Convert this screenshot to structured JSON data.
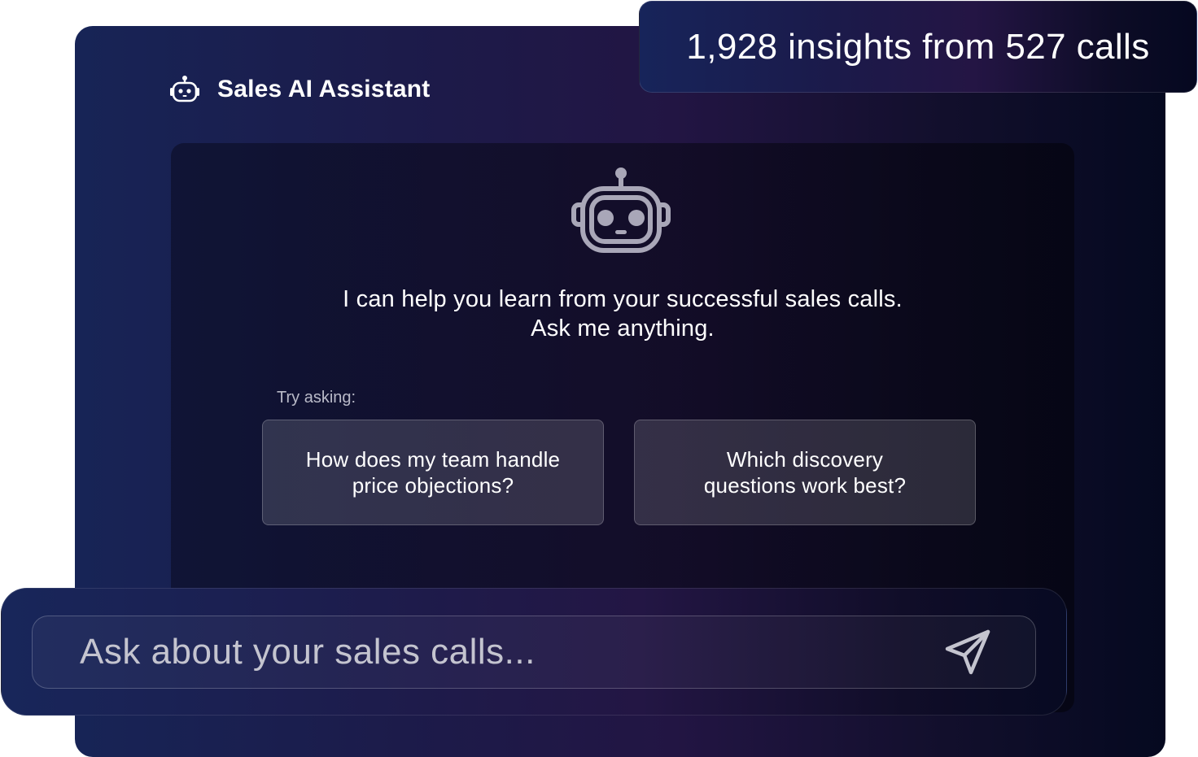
{
  "header": {
    "icon": "robot-icon",
    "title": "Sales AI Assistant"
  },
  "stats_badge": {
    "text": "1,928 insights from 527 calls"
  },
  "chat": {
    "avatar_icon": "robot-icon",
    "welcome_line1": "I can help you learn from your successful sales calls.",
    "welcome_line2": "Ask me anything.",
    "try_label": "Try asking:",
    "suggestions": [
      {
        "line1": "How does my team handle",
        "line2": "price objections?"
      },
      {
        "line1": "Which discovery",
        "line2": "questions work best?"
      }
    ]
  },
  "input": {
    "placeholder": "Ask about your sales calls...",
    "value": "",
    "send_icon": "paper-plane-icon"
  },
  "colors": {
    "background_navy": "#172456",
    "background_purple": "#221543",
    "background_dark": "#050920",
    "text": "#ffffff",
    "muted_text": "#b9bac8",
    "robot_icon": "#a9a7b8"
  }
}
